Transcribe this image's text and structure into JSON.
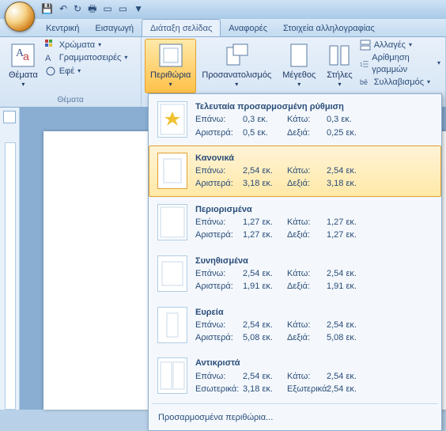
{
  "tabs": {
    "t0": "Κεντρική",
    "t1": "Εισαγωγή",
    "t2": "Διάταξη σελίδας",
    "t3": "Αναφορές",
    "t4": "Στοιχεία αλληλογραφίας"
  },
  "groups": {
    "themes": {
      "label": "Θέματα",
      "btn": "Θέματα",
      "colors": "Χρώματα",
      "fonts": "Γραμματοσειρές",
      "effects": "Εφέ"
    },
    "pagesetup": {
      "margins": "Περιθώρια",
      "orient": "Προσανατολισμός",
      "size": "Μέγεθος",
      "cols": "Στήλες",
      "breaks": "Αλλαγές",
      "linenums": "Αρίθμηση γραμμών",
      "hyph": "Συλλαβισμός"
    }
  },
  "menu": {
    "m0": {
      "title": "Τελευταία προσαρμοσμένη ρύθμιση",
      "topL": "Επάνω:",
      "topV": "0,3 εκ.",
      "botL": "Κάτω:",
      "botV": "0,3 εκ.",
      "leftL": "Αριστερά:",
      "leftV": "0,5 εκ.",
      "rightL": "Δεξιά:",
      "rightV": "0,25 εκ."
    },
    "m1": {
      "title": "Κανονικά",
      "topL": "Επάνω:",
      "topV": "2,54 εκ.",
      "botL": "Κάτω:",
      "botV": "2,54 εκ.",
      "leftL": "Αριστερά:",
      "leftV": "3,18 εκ.",
      "rightL": "Δεξιά:",
      "rightV": "3,18 εκ."
    },
    "m2": {
      "title": "Περιορισμένα",
      "topL": "Επάνω:",
      "topV": "1,27 εκ.",
      "botL": "Κάτω:",
      "botV": "1,27 εκ.",
      "leftL": "Αριστερά:",
      "leftV": "1,27 εκ.",
      "rightL": "Δεξιά:",
      "rightV": "1,27 εκ."
    },
    "m3": {
      "title": "Συνηθισμένα",
      "topL": "Επάνω:",
      "topV": "2,54 εκ.",
      "botL": "Κάτω:",
      "botV": "2,54 εκ.",
      "leftL": "Αριστερά:",
      "leftV": "1,91 εκ.",
      "rightL": "Δεξιά:",
      "rightV": "1,91 εκ."
    },
    "m4": {
      "title": "Ευρεία",
      "topL": "Επάνω:",
      "topV": "2,54 εκ.",
      "botL": "Κάτω:",
      "botV": "2,54 εκ.",
      "leftL": "Αριστερά:",
      "leftV": "5,08 εκ.",
      "rightL": "Δεξιά:",
      "rightV": "5,08 εκ."
    },
    "m5": {
      "title": "Αντικριστά",
      "topL": "Επάνω:",
      "topV": "2,54 εκ.",
      "botL": "Κάτω:",
      "botV": "2,54 εκ.",
      "leftL": "Εσωτερικά:",
      "leftV": "3,18 εκ.",
      "rightL": "Εξωτερικά:",
      "rightV": "2,54 εκ."
    },
    "custom": "Προσαρμοσμένα περιθώρια..."
  }
}
